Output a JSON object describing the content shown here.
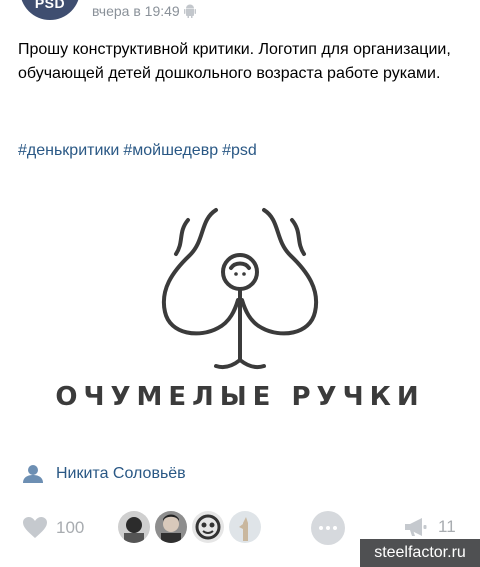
{
  "header": {
    "avatar_text": "PSD",
    "time": "вчера в 19:49",
    "platform_icon": "android-icon"
  },
  "post": {
    "text": "Прошу конструктивной критики. Логотип для организации, обучающей детей дошкольного возраста работе руками.",
    "hashtags": [
      "#денькритики",
      "#мойшедевр",
      "#psd"
    ]
  },
  "image": {
    "wordmark": "ОЧУМЕЛЫЕ РУЧКИ"
  },
  "author": {
    "icon": "user-icon",
    "name": "Никита Соловьёв"
  },
  "footer": {
    "like_icon": "heart-icon",
    "likes": "100",
    "liker_avatars": [
      "avatar-1",
      "avatar-2",
      "avatar-3",
      "avatar-4"
    ],
    "more_icon": "ellipsis-icon",
    "share_icon": "megaphone-icon",
    "shares": "11"
  },
  "watermark": "steelfactor.ru",
  "colors": {
    "link": "#2a5885",
    "muted": "#a8acb0",
    "avatar_bg": "#3f4e70"
  }
}
